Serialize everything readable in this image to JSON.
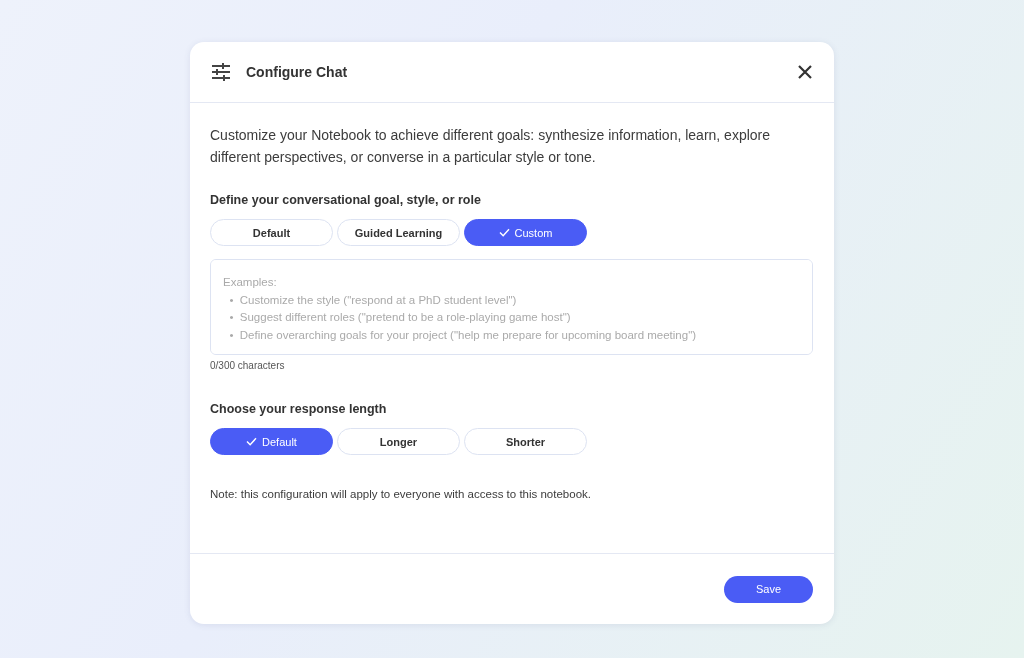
{
  "dialog": {
    "title": "Configure Chat",
    "intro": "Customize your Notebook to achieve different goals: synthesize information, learn, explore different perspectives, or converse in a particular style or tone.",
    "goal_section": {
      "heading": "Define your conversational goal, style, or role",
      "options": [
        {
          "label": "Default",
          "selected": false
        },
        {
          "label": "Guided Learning",
          "selected": false
        },
        {
          "label": "Custom",
          "selected": true
        }
      ],
      "prompt_field": {
        "placeholder_lines": [
          "Examples:",
          "  •  Customize the style (\"respond at a PhD student level\")",
          "  •  Suggest different roles (\"pretend to be a role-playing game host\")",
          "  •  Define overarching goals for your project (\"help me prepare for upcoming board meeting\")"
        ]
      },
      "counter": "0/300 characters"
    },
    "length_section": {
      "heading": "Choose your response length",
      "options": [
        {
          "label": "Default",
          "selected": true
        },
        {
          "label": "Longer",
          "selected": false
        },
        {
          "label": "Shorter",
          "selected": false
        }
      ]
    },
    "note": "Note: this configuration will apply to everyone with access to this notebook.",
    "save_button": "Save"
  }
}
